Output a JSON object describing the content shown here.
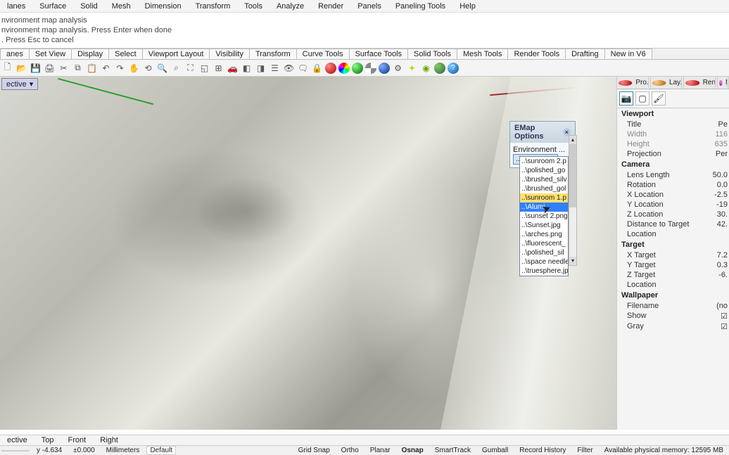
{
  "menu": [
    "lanes",
    "Surface",
    "Solid",
    "Mesh",
    "Dimension",
    "Transform",
    "Tools",
    "Analyze",
    "Render",
    "Panels",
    "Paneling Tools",
    "Help"
  ],
  "cmd": {
    "l1": "nvironment map analysis",
    "l2": "nvironment map analysis. Press Enter when done",
    "l3": ". Press Esc to cancel"
  },
  "tabs": [
    "anes",
    "Set View",
    "Display",
    "Select",
    "Viewport Layout",
    "Visibility",
    "Transform",
    "Curve Tools",
    "Surface Tools",
    "Solid Tools",
    "Mesh Tools",
    "Render Tools",
    "Drafting",
    "New in V6"
  ],
  "vp_label": "ective",
  "emap": {
    "title": "EMap Options",
    "label": "Environment ...",
    "selected": "..\\sunroon",
    "items": [
      "..\\sunroom 2.p",
      "..\\polished_go",
      "..\\brushed_silv",
      "..\\brushed_gol",
      "..\\sunroom 1.p",
      "..\\Alumi...",
      "..\\sunset 2.png",
      "..\\Sunset.jpg",
      "..\\arches.png",
      "..\\fluorescent_",
      "..\\polished_sil",
      "..\\space needle",
      "..\\truesphere.jp"
    ]
  },
  "rp_tabs": [
    "Pro...",
    "Lay...",
    "Ren...",
    "M"
  ],
  "props": {
    "viewport_h": "Viewport",
    "title_k": "Title",
    "title_v": "Pe",
    "width_k": "Width",
    "width_v": "116",
    "height_k": "Height",
    "height_v": "635",
    "proj_k": "Projection",
    "proj_v": "Per",
    "camera_h": "Camera",
    "lens_k": "Lens Length",
    "lens_v": "50.0",
    "rot_k": "Rotation",
    "rot_v": "0.0",
    "xloc_k": "X Location",
    "xloc_v": "-2.5",
    "yloc_k": "Y Location",
    "yloc_v": "-19",
    "zloc_k": "Z Location",
    "zloc_v": "30.",
    "dist_k": "Distance to Target",
    "dist_v": "42.",
    "loc_k": "Location",
    "target_h": "Target",
    "xt_k": "X Target",
    "xt_v": "7.2",
    "yt_k": "Y Target",
    "yt_v": "0.3",
    "zt_k": "Z Target",
    "zt_v": "-6.",
    "loc2_k": "Location",
    "wall_h": "Wallpaper",
    "fn_k": "Filename",
    "fn_v": "(no",
    "show_k": "Show",
    "gray_k": "Gray"
  },
  "status1": {
    "v1": "ective",
    "v2": "Top",
    "v3": "Front",
    "v4": "Right"
  },
  "status2": {
    "coord_y": "y -4.634",
    "coord_z": "±0.000",
    "units": "Millimeters",
    "layer": "Default",
    "gs": "Grid Snap",
    "or": "Ortho",
    "pl": "Planar",
    "os": "Osnap",
    "st": "SmartTrack",
    "gb": "Gumball",
    "rh": "Record History",
    "fl": "Filter",
    "mem": "Available physical memory: 12595 MB"
  }
}
